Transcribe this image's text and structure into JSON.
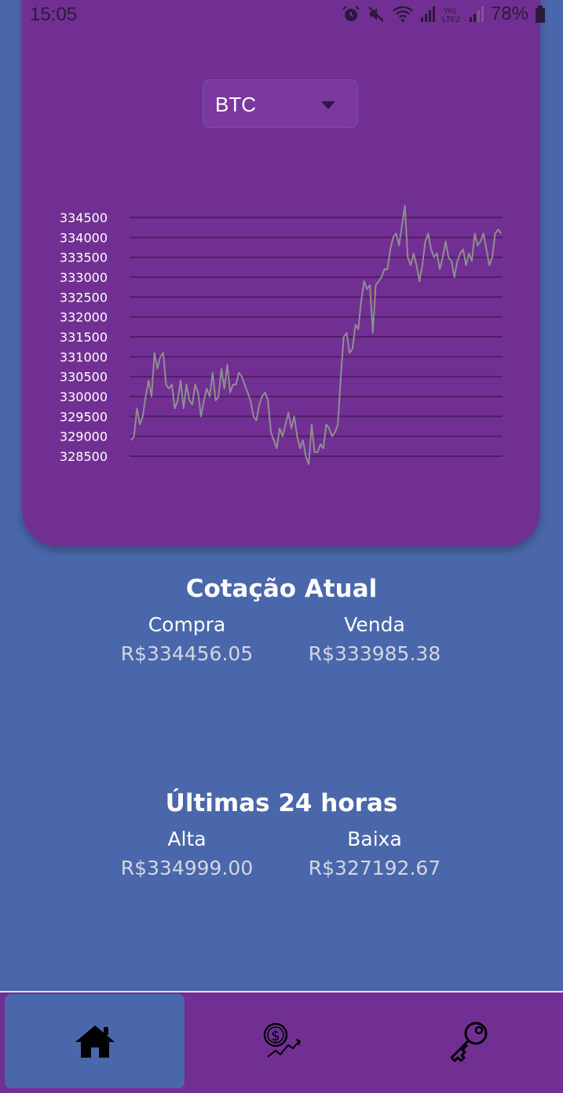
{
  "status_bar": {
    "time": "15:05",
    "battery": "78%",
    "icons": [
      "alarm-icon",
      "mute-icon",
      "wifi-icon",
      "signal-icon",
      "volte-icon",
      "signal-icon",
      "battery-icon"
    ]
  },
  "selector": {
    "value": "BTC",
    "icon": "caret-down-icon"
  },
  "chart_data": {
    "type": "line",
    "title": "",
    "xlabel": "",
    "ylabel": "",
    "ylim": [
      328500,
      334500
    ],
    "yticks": [
      "334500",
      "334000",
      "333500",
      "333000",
      "332500",
      "332000",
      "331500",
      "331000",
      "330500",
      "330000",
      "329500",
      "329000",
      "328500"
    ],
    "grid": true,
    "series": [
      {
        "color": "#8f8f8f",
        "values": [
          328900,
          329000,
          329700,
          329300,
          329500,
          330000,
          330400,
          330000,
          331100,
          330700,
          331000,
          331100,
          330300,
          330200,
          330300,
          329700,
          329900,
          330400,
          329700,
          330300,
          329900,
          329800,
          330300,
          330100,
          329500,
          329900,
          330200,
          330000,
          330600,
          329900,
          330000,
          330700,
          330200,
          330800,
          330100,
          330300,
          330300,
          330600,
          330500,
          330300,
          330100,
          329900,
          329500,
          329400,
          329800,
          330000,
          330100,
          329900,
          329100,
          328900,
          328700,
          329200,
          329000,
          329300,
          329600,
          329200,
          329500,
          329000,
          328700,
          328900,
          328500,
          328300,
          329300,
          328600,
          328600,
          328800,
          328700,
          329300,
          329200,
          329000,
          329100,
          329300,
          330500,
          331500,
          331600,
          331100,
          331200,
          331800,
          331700,
          332400,
          332900,
          332700,
          332800,
          331600,
          332800,
          332900,
          333000,
          333200,
          333200,
          333700,
          334000,
          334100,
          333800,
          334300,
          334800,
          333500,
          333300,
          333600,
          333300,
          332900,
          333300,
          333900,
          334100,
          333700,
          333500,
          333600,
          333200,
          333500,
          333900,
          333500,
          333400,
          333000,
          333400,
          333600,
          333700,
          333300,
          333600,
          333400,
          334100,
          333800,
          333900,
          334100,
          333700,
          333300,
          333500,
          334100,
          334200,
          334100
        ]
      }
    ]
  },
  "current_quote": {
    "title": "Cotação Atual",
    "buy_label": "Compra",
    "buy_value": "R$334456.05",
    "sell_label": "Venda",
    "sell_value": "R$333985.38"
  },
  "last_24h": {
    "title": "Últimas 24 horas",
    "high_label": "Alta",
    "high_value": "R$334999.00",
    "low_label": "Baixa",
    "low_value": "R$327192.67"
  },
  "nav": {
    "items": [
      {
        "icon": "home-icon",
        "active": true
      },
      {
        "icon": "dollar-chart-icon",
        "active": false
      },
      {
        "icon": "key-icon",
        "active": false
      }
    ],
    "colors": {
      "bar": "#722f93",
      "active": "#4a67ab"
    }
  },
  "colors": {
    "background": "#4a67ab",
    "card": "#722f93",
    "line": "#8f8f8f",
    "grid": "#4e1e68"
  }
}
